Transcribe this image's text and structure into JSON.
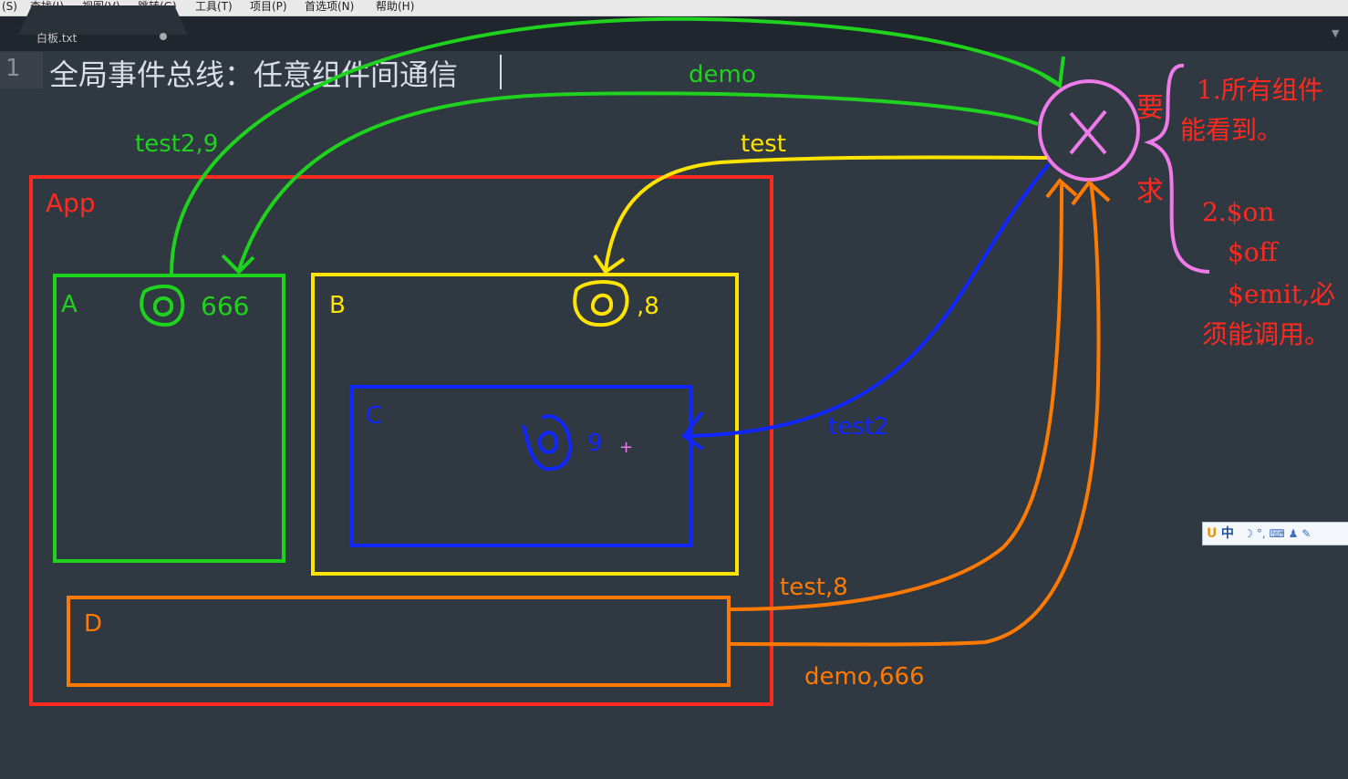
{
  "menubar": {
    "items": [
      "(S)",
      "查找(I)",
      "视图(V)",
      "跳转(G)",
      "工具(T)",
      "项目(P)",
      "首选项(N)",
      "帮助(H)"
    ]
  },
  "tab": {
    "label": "白板.txt"
  },
  "editor": {
    "line_number": "1",
    "text": "全局事件总线：任意组件间通信"
  },
  "diagram": {
    "app_label": "App",
    "a_label": "A",
    "b_label": "B",
    "c_label": "C",
    "d_label": "D",
    "a_value": "666",
    "b_value": ",8",
    "c_value": "9",
    "edge_demo": "demo",
    "edge_test29": "test2,9",
    "edge_test": "test",
    "edge_test2": "test2",
    "edge_test8": "test,8",
    "edge_demo666": "demo,666",
    "bus_symbol": "X",
    "req_yao": "要",
    "req_qiu": "求",
    "req1_line1": "1.所有组件",
    "req1_line2": "能看到。",
    "req2_line1": "2.$on",
    "req2_line2": "$off",
    "req2_line3": "$emit,必",
    "req2_line4": "须能调用。"
  },
  "ime": {
    "logo": "U",
    "lang": "中",
    "rest": "☽ °, ⌨ ♟ ✎"
  },
  "colors": {
    "background": "#303841",
    "red": "#ff2a1f",
    "green": "#1ed21e",
    "yellow": "#ffe400",
    "blue": "#1027ff",
    "orange": "#ff7a00",
    "pink": "#ee7be9"
  }
}
